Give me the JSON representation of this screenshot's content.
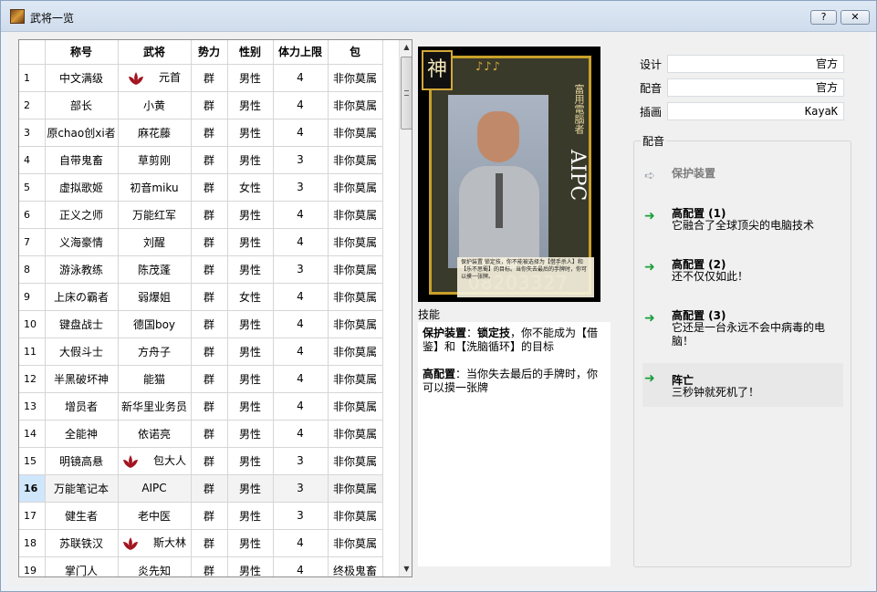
{
  "window": {
    "title": "武将一览",
    "help_label": "?",
    "close_label": "✕"
  },
  "table": {
    "columns": [
      "",
      "称号",
      "武将",
      "势力",
      "性别",
      "体力上限",
      "包"
    ],
    "rows": [
      {
        "n": "1",
        "title": "中文满级",
        "name": "元首",
        "kingdom": "群",
        "gender": "男性",
        "hp": "4",
        "pack": "非你莫属",
        "lotus": true
      },
      {
        "n": "2",
        "title": "部长",
        "name": "小黄",
        "kingdom": "群",
        "gender": "男性",
        "hp": "4",
        "pack": "非你莫属",
        "lotus": false
      },
      {
        "n": "3",
        "title": "原chao创xi者",
        "name": "麻花藤",
        "kingdom": "群",
        "gender": "男性",
        "hp": "4",
        "pack": "非你莫属",
        "lotus": false
      },
      {
        "n": "4",
        "title": "自带鬼畜",
        "name": "草剪刚",
        "kingdom": "群",
        "gender": "男性",
        "hp": "3",
        "pack": "非你莫属",
        "lotus": false
      },
      {
        "n": "5",
        "title": "虚拟歌姬",
        "name": "初音miku",
        "kingdom": "群",
        "gender": "女性",
        "hp": "3",
        "pack": "非你莫属",
        "lotus": false
      },
      {
        "n": "6",
        "title": "正义之师",
        "name": "万能红军",
        "kingdom": "群",
        "gender": "男性",
        "hp": "4",
        "pack": "非你莫属",
        "lotus": false
      },
      {
        "n": "7",
        "title": "义海豪情",
        "name": "刘醒",
        "kingdom": "群",
        "gender": "男性",
        "hp": "4",
        "pack": "非你莫属",
        "lotus": false
      },
      {
        "n": "8",
        "title": "游泳教练",
        "name": "陈茂蓬",
        "kingdom": "群",
        "gender": "男性",
        "hp": "3",
        "pack": "非你莫属",
        "lotus": false
      },
      {
        "n": "9",
        "title": "上床の霸者",
        "name": "弱爆姐",
        "kingdom": "群",
        "gender": "女性",
        "hp": "4",
        "pack": "非你莫属",
        "lotus": false
      },
      {
        "n": "10",
        "title": "键盘战士",
        "name": "德国boy",
        "kingdom": "群",
        "gender": "男性",
        "hp": "4",
        "pack": "非你莫属",
        "lotus": false
      },
      {
        "n": "11",
        "title": "大假斗士",
        "name": "方舟子",
        "kingdom": "群",
        "gender": "男性",
        "hp": "4",
        "pack": "非你莫属",
        "lotus": false
      },
      {
        "n": "12",
        "title": "半黑破坏神",
        "name": "能猫",
        "kingdom": "群",
        "gender": "男性",
        "hp": "4",
        "pack": "非你莫属",
        "lotus": false
      },
      {
        "n": "13",
        "title": "增员者",
        "name": "新华里业务员",
        "kingdom": "群",
        "gender": "男性",
        "hp": "4",
        "pack": "非你莫属",
        "lotus": false
      },
      {
        "n": "14",
        "title": "全能神",
        "name": "依诺亮",
        "kingdom": "群",
        "gender": "男性",
        "hp": "4",
        "pack": "非你莫属",
        "lotus": false
      },
      {
        "n": "15",
        "title": "明镜高悬",
        "name": "包大人",
        "kingdom": "群",
        "gender": "男性",
        "hp": "3",
        "pack": "非你莫属",
        "lotus": true
      },
      {
        "n": "16",
        "title": "万能笔记本",
        "name": "AIPC",
        "kingdom": "群",
        "gender": "男性",
        "hp": "3",
        "pack": "非你莫属",
        "lotus": false,
        "selected": true
      },
      {
        "n": "17",
        "title": "健生者",
        "name": "老中医",
        "kingdom": "群",
        "gender": "男性",
        "hp": "3",
        "pack": "非你莫属",
        "lotus": false
      },
      {
        "n": "18",
        "title": "苏联铁汉",
        "name": "斯大林",
        "kingdom": "群",
        "gender": "男性",
        "hp": "4",
        "pack": "非你莫属",
        "lotus": true
      },
      {
        "n": "19",
        "title": "掌门人",
        "name": "炎先知",
        "kingdom": "群",
        "gender": "男性",
        "hp": "4",
        "pack": "终极鬼畜",
        "lotus": false
      }
    ]
  },
  "card": {
    "badge": "神",
    "hp_marks": "♪♪♪",
    "title": "富用電腦者",
    "name": "AIPC",
    "skill_snippet": "保护装置 锁定技，你不能被选择为【借手杀人】和【乐不思蜀】的目标。当你失去最后的手牌时，你可以摸一张牌。",
    "number": "08203327"
  },
  "skill_panel": {
    "caption": "技能",
    "skills": [
      {
        "name": "保护装置",
        "sep": "：",
        "tag": "锁定技",
        "desc": "，你不能成为【借鉴】和【洗脑循环】的目标"
      },
      {
        "name": "高配置",
        "sep": "：",
        "tag": "",
        "desc": "当你失去最后的手牌时，你可以摸一张牌"
      }
    ]
  },
  "info": {
    "design_label": "设计",
    "design_value": "官方",
    "voice_label": "配音",
    "voice_value": "官方",
    "art_label": "插画",
    "art_value": "KayaK"
  },
  "voice_group": {
    "title": "配音",
    "items": [
      {
        "title": "保护装置",
        "line1": "",
        "line2": "",
        "disabled": true
      },
      {
        "title": "高配置 (1)",
        "line1": "它融合了全球顶尖的电脑技术",
        "line2": "",
        "disabled": false
      },
      {
        "title": "高配置 (2)",
        "line1": "还不仅仅如此！",
        "line2": "",
        "disabled": false
      },
      {
        "title": "高配置 (3)",
        "line1": "它还是一台永远不会中病毒的电",
        "line2": "脑！",
        "disabled": false
      },
      {
        "title": "阵亡",
        "line1": "三秒钟就死机了！",
        "line2": "",
        "disabled": false,
        "highlight": true
      }
    ]
  },
  "colors": {
    "accent_green": "#1a9e3a",
    "lotus_red": "#a31520",
    "selection_blue": "#cfe6fb"
  }
}
